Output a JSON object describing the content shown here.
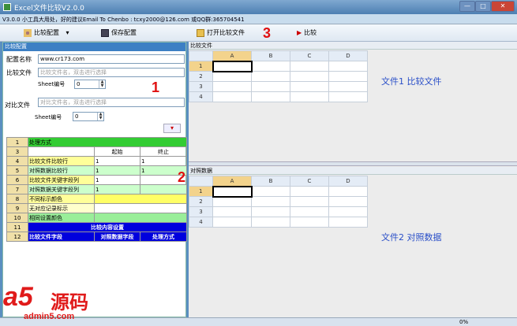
{
  "window": {
    "title": "Excel文件比较V2.0.0",
    "minimize": "—",
    "maximize": "□",
    "close": "✕"
  },
  "infobar": {
    "text": "V3.0.0  小工具大用处，好的建议Email To Chenbo : tcxy2000@126.com  或QQ群:365704541"
  },
  "toolbar": {
    "config_label": "比较配置",
    "save_label": "保存配置",
    "open_label": "打开比较文件",
    "compare_label": "比较"
  },
  "left": {
    "section_title": "比较配置",
    "config_name_label": "配置名称",
    "config_name_value": "www.cr173.com",
    "compare_file_label": "比较文件",
    "compare_file_placeholder": "比较文件名，双击进行选择",
    "sheet_no_label": "Sheet编号",
    "sheet_no_value": "0",
    "ref_file_label": "对比文件",
    "ref_file_placeholder": "对比文件名，双击进行选择",
    "ref_sheet_no_label": "Sheet编号",
    "ref_sheet_no_value": "0"
  },
  "grid": {
    "rows": [
      {
        "n": "1",
        "label": "处理方式",
        "c1": "",
        "c2": ""
      },
      {
        "n": "3",
        "label": "",
        "c1": "起始",
        "c2": "终止"
      },
      {
        "n": "4",
        "label": "比较文件比较行",
        "c1": "1",
        "c2": "1"
      },
      {
        "n": "5",
        "label": "对照数据比较行",
        "c1": "1",
        "c2": "1"
      },
      {
        "n": "6",
        "label": "比较文件关键字段列",
        "c1": "1",
        "c2": ""
      },
      {
        "n": "7",
        "label": "对照数据关键字段列",
        "c1": "1",
        "c2": ""
      },
      {
        "n": "8",
        "label": "不同标示颜色",
        "c1": "",
        "c2": ""
      },
      {
        "n": "9",
        "label": "无对应记录标示",
        "c1": "",
        "c2": ""
      },
      {
        "n": "10",
        "label": "相同设置颜色",
        "c1": "",
        "c2": ""
      },
      {
        "n": "11",
        "label": "比较内容设置",
        "c1": "",
        "c2": ""
      },
      {
        "n": "12",
        "label": "比较文件字段",
        "c1": "对照数据字段",
        "c2": "处理方式"
      }
    ]
  },
  "right": {
    "top_title": "比较文件",
    "top_note": "文件1 比较文件",
    "bottom_title": "对照数据",
    "bottom_note": "文件2 对照数据",
    "cols": [
      "A",
      "B",
      "C",
      "D"
    ],
    "rows": [
      "1",
      "2",
      "3",
      "4"
    ]
  },
  "markers": {
    "m1": "1",
    "m2": "2",
    "m3": "3"
  },
  "status": {
    "progress_text": "0%"
  },
  "watermark": {
    "brand": "a5",
    "cn": "源码",
    "site": "admin5.com"
  },
  "colors": {
    "accent": "#3c7fc4",
    "marker": "#e01010",
    "green": "#33cc33",
    "yellow": "#ffff99",
    "blue_row": "#0000dd"
  }
}
